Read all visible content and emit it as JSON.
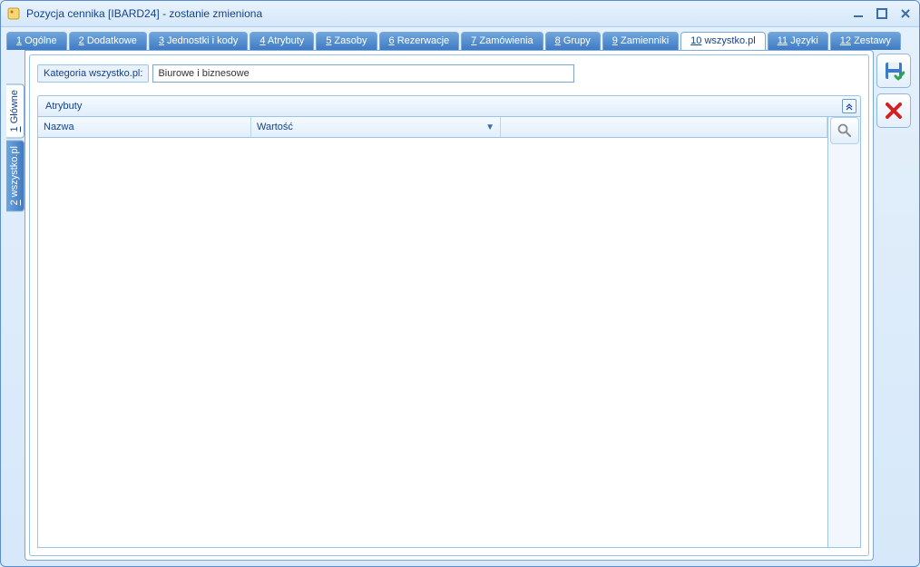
{
  "window": {
    "title": "Pozycja cennika [IBARD24] - zostanie zmieniona"
  },
  "tabs": [
    {
      "num": "1",
      "label": "Ogólne"
    },
    {
      "num": "2",
      "label": "Dodatkowe"
    },
    {
      "num": "3",
      "label": "Jednostki i kody"
    },
    {
      "num": "4",
      "label": "Atrybuty"
    },
    {
      "num": "5",
      "label": "Zasoby"
    },
    {
      "num": "6",
      "label": "Rezerwacje"
    },
    {
      "num": "7",
      "label": "Zamówienia"
    },
    {
      "num": "8",
      "label": "Grupy"
    },
    {
      "num": "9",
      "label": "Zamienniki"
    },
    {
      "num": "10",
      "label": "wszystko.pl",
      "active": true
    },
    {
      "num": "11",
      "label": "Języki"
    },
    {
      "num": "12",
      "label": "Zestawy"
    }
  ],
  "vtabs": [
    {
      "num": "1",
      "label": "Główne",
      "active": true
    },
    {
      "num": "2",
      "label": "wszystko.pl"
    }
  ],
  "form": {
    "kategoria_label": "Kategoria wszystko.pl:",
    "kategoria_value": "Biurowe i biznesowe"
  },
  "group": {
    "title": "Atrybuty",
    "col_nazwa": "Nazwa",
    "col_wartosc": "Wartość"
  }
}
